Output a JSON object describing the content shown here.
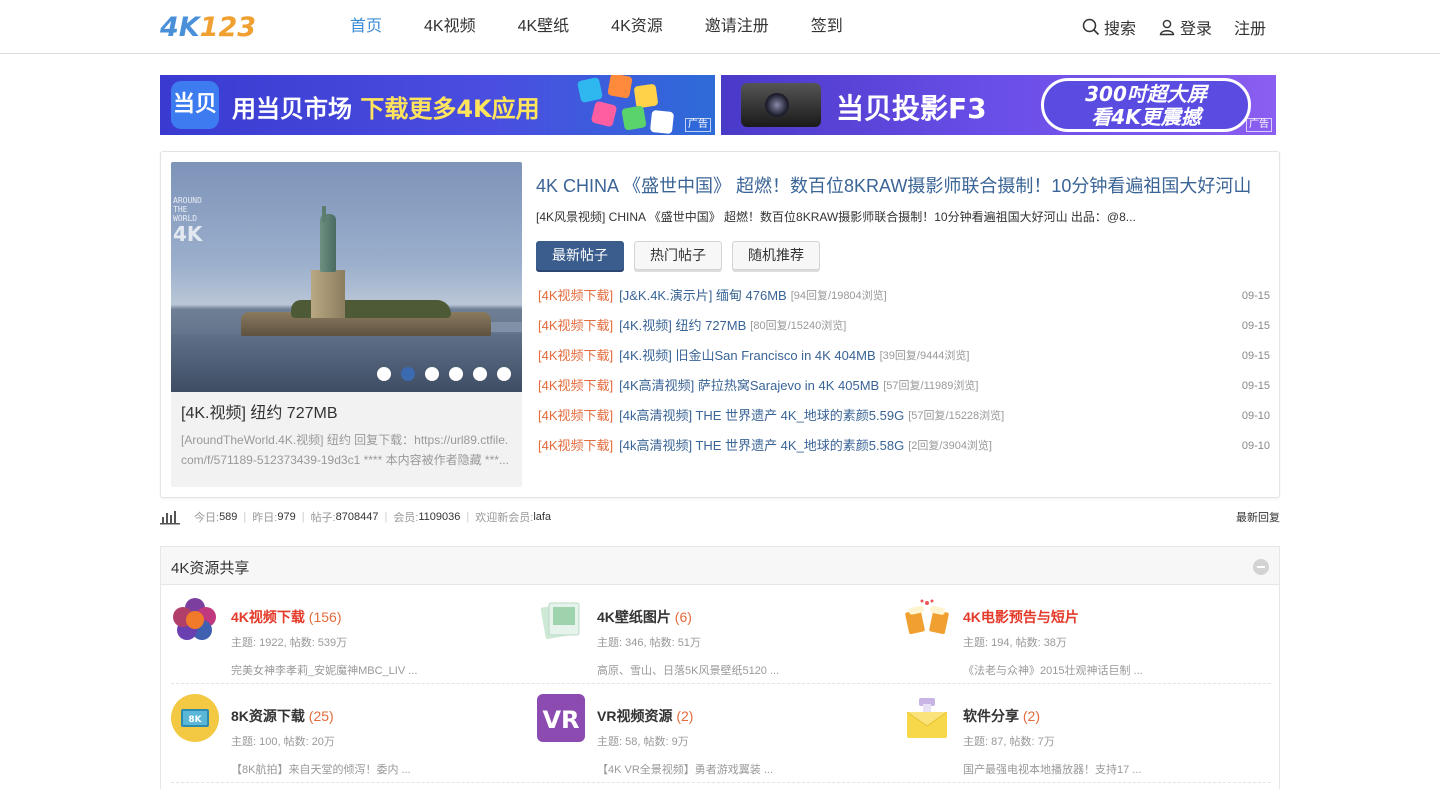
{
  "header": {
    "logo_a": "4K",
    "logo_b": "123",
    "nav": [
      "首页",
      "4K视频",
      "4K壁纸",
      "4K资源",
      "邀请注册",
      "签到"
    ],
    "search": "搜索",
    "login": "登录",
    "register": "注册"
  },
  "ads": {
    "left": {
      "icon": "当贝",
      "text_a": "用当贝市场 ",
      "text_b": "下载更多4K应用",
      "tag": "广告"
    },
    "right": {
      "text": "当贝投影F3",
      "pill_line1": "300吋超大屏",
      "pill_line2": "看4K更震撼",
      "tag": "广告"
    }
  },
  "featured": {
    "watermark_small": "AROUND THE WORLD",
    "watermark_big": "4K",
    "slide_title": "[4K.视频] 纽约 727MB",
    "slide_desc": "[AroundTheWorld.4K.视频] 纽约 回复下载：https://url89.ctfile.com/f/571189-512373439-19d3c1 **** 本内容被作者隐藏 ***...",
    "title": "4K CHINA 《盛世中国》 超燃！数百位8KRAW摄影师联合摄制！10分钟看遍祖国大好河山",
    "desc": "[4K风景视频] CHINA 《盛世中国》 超燃！数百位8KRAW摄影师联合摄制！10分钟看遍祖国大好河山 出品：@8...",
    "tabs": [
      "最新帖子",
      "热门帖子",
      "随机推荐"
    ],
    "threads": [
      {
        "cat": "[4K视频下载]",
        "title": "[J&K.4K.演示片] 缅甸 476MB",
        "stats": "[94回复/19804浏览]",
        "date": "09-15"
      },
      {
        "cat": "[4K视频下载]",
        "title": "[4K.视频] 纽约 727MB",
        "stats": "[80回复/15240浏览]",
        "date": "09-15"
      },
      {
        "cat": "[4K视频下载]",
        "title": "[4K.视频] 旧金山San Francisco in 4K 404MB",
        "stats": "[39回复/9444浏览]",
        "date": "09-15"
      },
      {
        "cat": "[4K视频下载]",
        "title": "[4K高清视频] 萨拉热窝Sarajevo in 4K 405MB",
        "stats": "[57回复/11989浏览]",
        "date": "09-15"
      },
      {
        "cat": "[4K视频下载]",
        "title": "[4k高清视频] THE 世界遗产 4K_地球的素颜5.59G",
        "stats": "[57回复/15228浏览]",
        "date": "09-10"
      },
      {
        "cat": "[4K视频下载]",
        "title": "[4k高清视频] THE 世界遗产 4K_地球的素颜5.58G",
        "stats": "[2回复/3904浏览]",
        "date": "09-10"
      }
    ]
  },
  "stats": {
    "today_label": "今日: ",
    "today": "589",
    "yesterday_label": "昨日: ",
    "yesterday": "979",
    "posts_label": "帖子: ",
    "posts": "8708447",
    "members_label": "会员: ",
    "members": "1109036",
    "newest_label": "欢迎新会员: ",
    "newest": "lafa",
    "latest_replies": "最新回复"
  },
  "section": {
    "title": "4K资源共享",
    "forums": [
      {
        "name": "4K视频下载",
        "count": "(156)",
        "meta": "主题: 1922, 帖数: 539万",
        "last": "完美女神李孝莉_安妮魔神MBC_LIV ...",
        "hot": true,
        "icon": "flower-icon"
      },
      {
        "name": "4K壁纸图片",
        "count": "(6)",
        "meta": "主题: 346, 帖数: 51万",
        "last": "高原、雪山、日落5K风景壁纸5120 ...",
        "hot": false,
        "icon": "photos-icon"
      },
      {
        "name": "4K电影预告与短片",
        "count": "",
        "meta": "主题: 194, 帖数: 38万",
        "last": "《法老与众神》2015壮观神话巨制 ...",
        "hot": true,
        "icon": "beer-icon"
      },
      {
        "name": "8K资源下载",
        "count": "(25)",
        "meta": "主题: 100, 帖数: 20万",
        "last": "【8K航拍】来自天堂的倾泻！委内 ...",
        "hot": false,
        "icon": "8k-tv-icon"
      },
      {
        "name": "VR视频资源",
        "count": "(2)",
        "meta": "主题: 58, 帖数: 9万",
        "last": "【4K VR全景视频】勇者游戏翼装 ...",
        "hot": false,
        "icon": "vr-icon"
      },
      {
        "name": "软件分享",
        "count": "(2)",
        "meta": "主题: 87, 帖数: 7万",
        "last": "国产最强电视本地播放器！支持17 ...",
        "hot": false,
        "icon": "box-icon"
      }
    ],
    "badge_8k": "8K",
    "badge_vr": "VR"
  }
}
